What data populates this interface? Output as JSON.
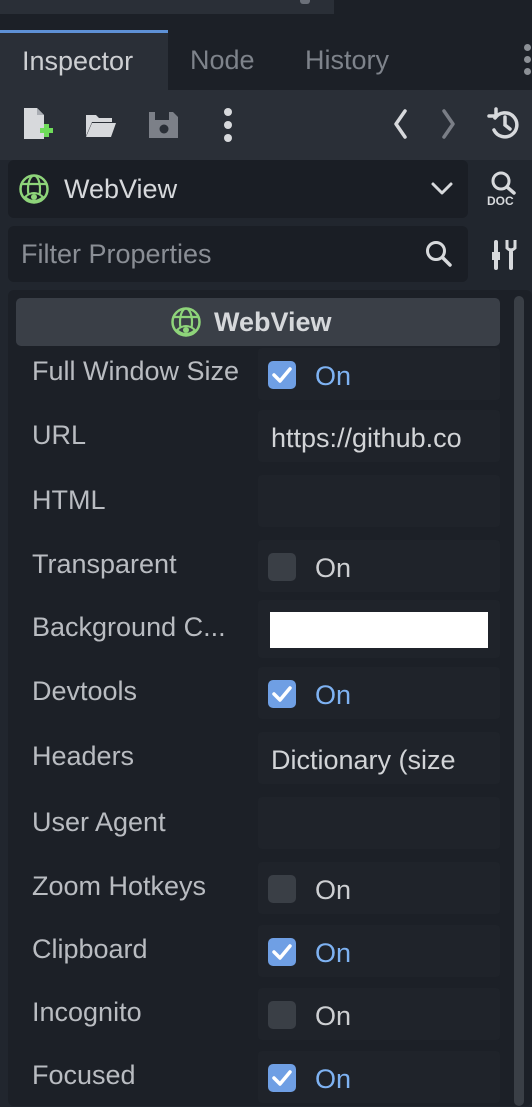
{
  "tabs": {
    "inspector": "Inspector",
    "node": "Node",
    "history": "History"
  },
  "object_selector": {
    "label": "WebView"
  },
  "filter": {
    "placeholder": "Filter Properties"
  },
  "section": {
    "title": "WebView"
  },
  "properties": [
    {
      "label": "Full Window Size",
      "type": "bool",
      "checked": true,
      "text": "On"
    },
    {
      "label": "URL",
      "type": "text",
      "value": "https://github.co"
    },
    {
      "label": "HTML",
      "type": "text",
      "value": ""
    },
    {
      "label": "Transparent",
      "type": "bool",
      "checked": false,
      "text": "On"
    },
    {
      "label": "Background C...",
      "type": "color",
      "color": "#ffffff"
    },
    {
      "label": "Devtools",
      "type": "bool",
      "checked": true,
      "text": "On"
    },
    {
      "label": "Headers",
      "type": "text",
      "value": "Dictionary (size"
    },
    {
      "label": "User Agent",
      "type": "text",
      "value": ""
    },
    {
      "label": "Zoom Hotkeys",
      "type": "bool",
      "checked": false,
      "text": "On"
    },
    {
      "label": "Clipboard",
      "type": "bool",
      "checked": true,
      "text": "On"
    },
    {
      "label": "Incognito",
      "type": "bool",
      "checked": false,
      "text": "On"
    },
    {
      "label": "Focused",
      "type": "bool",
      "checked": true,
      "text": "On"
    }
  ],
  "icons": {
    "toolbar": [
      "new-resource-icon",
      "open-folder-icon",
      "save-icon",
      "more-options-icon",
      "back-icon",
      "forward-icon",
      "history-icon"
    ],
    "object": "webview-globe-icon",
    "doc": "doc-icon",
    "search": "search-icon",
    "tools": "property-tools-icon"
  },
  "colors": {
    "accent": "#5e91d6",
    "checked": "#6f9fe4",
    "on_text": "#7eb2f2",
    "globe": "#8ed47a"
  }
}
